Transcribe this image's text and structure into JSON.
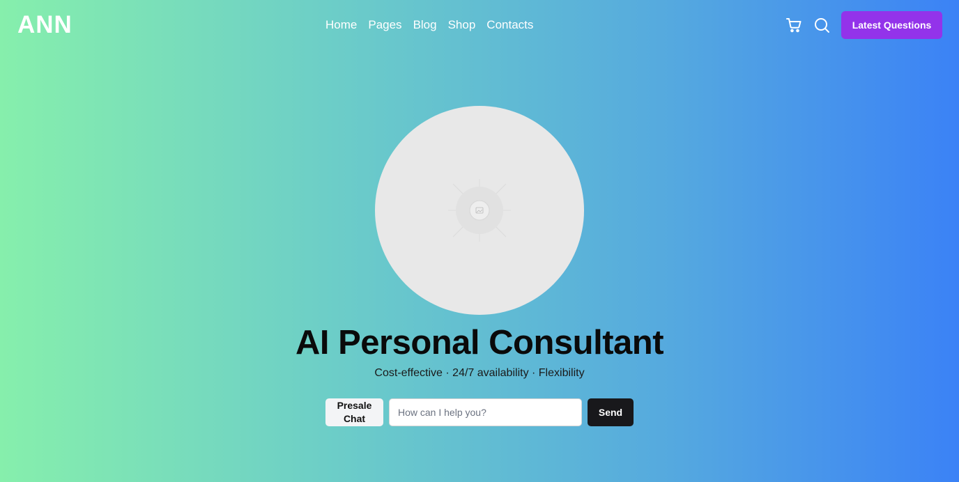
{
  "header": {
    "logo": "ANN",
    "nav": [
      {
        "label": "Home"
      },
      {
        "label": "Pages"
      },
      {
        "label": "Blog"
      },
      {
        "label": "Shop"
      },
      {
        "label": "Contacts"
      }
    ],
    "icons": [
      "cart-icon",
      "search-icon"
    ],
    "cta_label": "Latest Questions"
  },
  "hero": {
    "image_icon": "image-placeholder-icon",
    "title": "AI Personal Consultant",
    "subtitle": "Cost-effective · 24/7 availability · Flexibility"
  },
  "chat": {
    "presale_label": "Presale Chat",
    "input_value": "",
    "input_placeholder": "How can I help you?",
    "send_label": "Send"
  },
  "colors": {
    "gradient_start": "#86efac",
    "gradient_end": "#3b82f6",
    "cta": "#9333ea",
    "send": "#18181b",
    "placeholder_circle": "#e8e8e8"
  }
}
